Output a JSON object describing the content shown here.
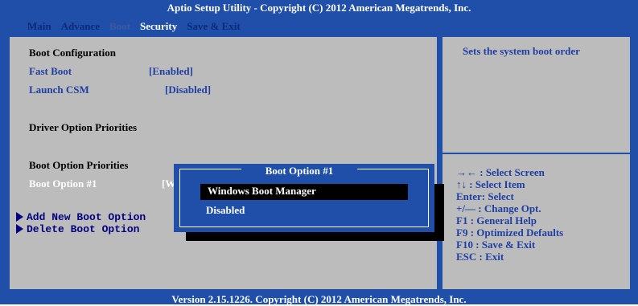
{
  "header": {
    "title": "Aptio Setup Utility - Copyright (C) 2012 American Megatrends, Inc.",
    "tabs": [
      {
        "label": "Main",
        "state": "normal"
      },
      {
        "label": "Advance",
        "state": "normal"
      },
      {
        "label": "Boot",
        "state": "dim"
      },
      {
        "label": "Security",
        "state": "active"
      },
      {
        "label": "Save & Exit",
        "state": "normal"
      }
    ]
  },
  "main": {
    "boot_configuration": "Boot Configuration",
    "fast_boot_label": "Fast Boot",
    "fast_boot_value": "[Enabled]",
    "launch_csm_label": "Launch CSM",
    "launch_csm_value": "[Disabled]",
    "driver_option_priorities": "Driver Option Priorities",
    "boot_option_priorities": "Boot Option Priorities",
    "boot_option_1_label": "Boot Option #1",
    "boot_option_1_value_partial": "[W",
    "add_new_boot_option": "Add New Boot Option",
    "delete_boot_option": "Delete Boot Option"
  },
  "popup": {
    "title": "Boot Option #1",
    "options": [
      "Windows Boot Manager",
      "Disabled"
    ],
    "selected_index": 0
  },
  "help": {
    "description": "Sets the system boot order",
    "keys": [
      "→←   : Select Screen",
      "↑↓  : Select Item",
      "Enter: Select",
      "+/—  : Change Opt.",
      "F1   : General Help",
      "F9   : Optimized Defaults",
      "F10  : Save & Exit",
      "ESC  : Exit"
    ]
  },
  "footer": {
    "version": "Version 2.15.1226. Copyright (C) 2012 American Megatrends, Inc."
  },
  "colors": {
    "frame_blue": "#1f4fa8",
    "panel_gray": "#bcbcbc",
    "text_blue": "#1f3fa3"
  }
}
